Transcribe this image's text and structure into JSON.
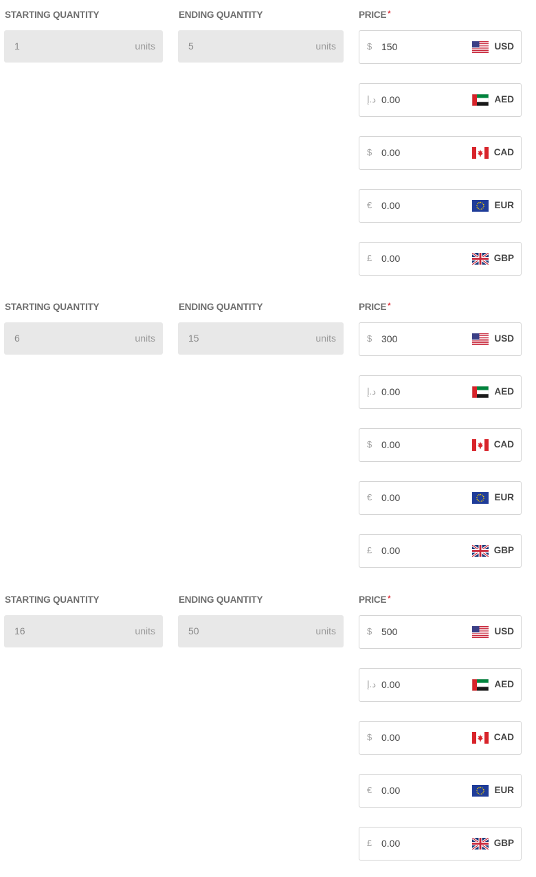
{
  "labels": {
    "starting_quantity": "STARTING QUANTITY",
    "ending_quantity": "ENDING QUANTITY",
    "price": "PRICE",
    "required_marker": "*",
    "units": "units"
  },
  "tiers": [
    {
      "start": "1",
      "end": "5",
      "prices": [
        {
          "symbol": "$",
          "amount": "150",
          "currency": "USD",
          "flag": "us-flag-icon"
        },
        {
          "symbol": "د.إ",
          "amount": "0.00",
          "currency": "AED",
          "flag": "uae-flag-icon"
        },
        {
          "symbol": "$",
          "amount": "0.00",
          "currency": "CAD",
          "flag": "canada-flag-icon"
        },
        {
          "symbol": "€",
          "amount": "0.00",
          "currency": "EUR",
          "flag": "eu-flag-icon"
        },
        {
          "symbol": "£",
          "amount": "0.00",
          "currency": "GBP",
          "flag": "uk-flag-icon"
        }
      ]
    },
    {
      "start": "6",
      "end": "15",
      "prices": [
        {
          "symbol": "$",
          "amount": "300",
          "currency": "USD",
          "flag": "us-flag-icon"
        },
        {
          "symbol": "د.إ",
          "amount": "0.00",
          "currency": "AED",
          "flag": "uae-flag-icon"
        },
        {
          "symbol": "$",
          "amount": "0.00",
          "currency": "CAD",
          "flag": "canada-flag-icon"
        },
        {
          "symbol": "€",
          "amount": "0.00",
          "currency": "EUR",
          "flag": "eu-flag-icon"
        },
        {
          "symbol": "£",
          "amount": "0.00",
          "currency": "GBP",
          "flag": "uk-flag-icon"
        }
      ]
    },
    {
      "start": "16",
      "end": "50",
      "prices": [
        {
          "symbol": "$",
          "amount": "500",
          "currency": "USD",
          "flag": "us-flag-icon"
        },
        {
          "symbol": "د.إ",
          "amount": "0.00",
          "currency": "AED",
          "flag": "uae-flag-icon"
        },
        {
          "symbol": "$",
          "amount": "0.00",
          "currency": "CAD",
          "flag": "canada-flag-icon"
        },
        {
          "symbol": "€",
          "amount": "0.00",
          "currency": "EUR",
          "flag": "eu-flag-icon"
        },
        {
          "symbol": "£",
          "amount": "0.00",
          "currency": "GBP",
          "flag": "uk-flag-icon"
        }
      ]
    }
  ],
  "colors": {
    "required": "#e0303a",
    "disabled_field_bg": "#e8e8e8",
    "border": "#d4d4d4"
  }
}
